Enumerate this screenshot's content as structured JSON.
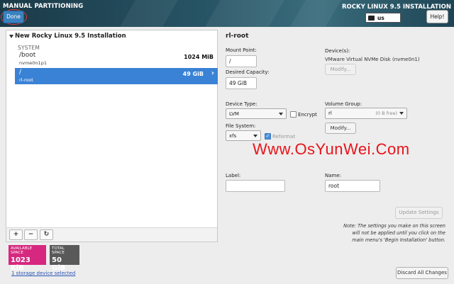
{
  "header": {
    "title": "MANUAL PARTITIONING",
    "done_label": "Done",
    "product": "ROCKY LINUX 9.5 INSTALLATION",
    "keyboard_layout": "us",
    "help_label": "Help!"
  },
  "partitions": {
    "installation_title": "New Rocky Linux 9.5 Installation",
    "system_label": "SYSTEM",
    "items": [
      {
        "mount": "/boot",
        "device": "nvme0n1p1",
        "size": "1024 MiB"
      },
      {
        "mount": "/",
        "device": "rl-root",
        "size": "49 GiB"
      }
    ]
  },
  "toolbar": {
    "add": "+",
    "remove": "−",
    "refresh": "↻"
  },
  "space": {
    "available_label": "AVAILABLE SPACE",
    "available_value": "1023 KiB",
    "total_label": "TOTAL SPACE",
    "total_value": "50 GiB",
    "available_color": "#d6287f",
    "total_color": "#595959"
  },
  "storage_link": "1 storage device selected",
  "details": {
    "title": "rl-root",
    "mount_point_label": "Mount Point:",
    "mount_point_value": "/",
    "desired_capacity_label": "Desired Capacity:",
    "desired_capacity_value": "49 GiB",
    "devices_label": "Device(s):",
    "devices_value": "VMware Virtual NVMe Disk (nvme0n1)",
    "modify_label": "Modify...",
    "device_type_label": "Device Type:",
    "device_type_value": "LVM",
    "encrypt_label": "Encrypt",
    "volume_group_label": "Volume Group:",
    "volume_group_value": "rl",
    "volume_group_free": "(0 B free)",
    "vg_modify_label": "Modify...",
    "file_system_label": "File System:",
    "file_system_value": "xfs",
    "reformat_label": "Reformat",
    "label_label": "Label:",
    "label_value": "",
    "name_label": "Name:",
    "name_value": "root",
    "update_settings_label": "Update Settings",
    "note_prefix": "Note:",
    "note_text": "The settings you make on this screen will not be applied until you click on the main menu's 'Begin Installation' button.",
    "discard_label": "Discard All Changes"
  },
  "watermark": "Www.OsYunWei.Com"
}
